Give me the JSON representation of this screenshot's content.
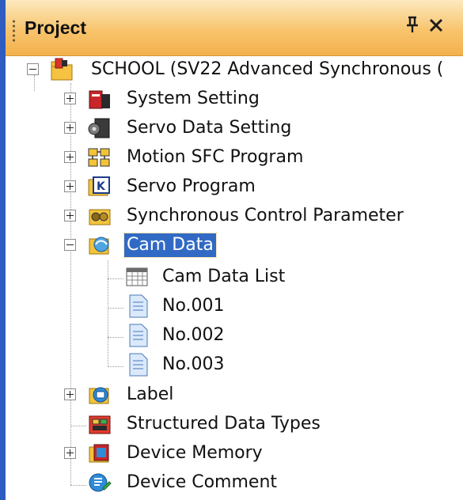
{
  "panel": {
    "title": "Project",
    "pin_icon": "pin-icon",
    "close_icon": "close-icon",
    "pin_glyph": "ᵖ",
    "close_glyph": "✕"
  },
  "tree": {
    "root": {
      "label": "SCHOOL (SV22 Advanced Synchronous (",
      "icon": "project-folder-icon",
      "expanded": true
    },
    "items": [
      {
        "label": "System Setting",
        "icon": "system-setting-icon",
        "expander": "plus"
      },
      {
        "label": "Servo Data Setting",
        "icon": "servo-data-icon",
        "expander": "plus"
      },
      {
        "label": "Motion SFC Program",
        "icon": "sfc-program-icon",
        "expander": "plus"
      },
      {
        "label": "Servo Program",
        "icon": "servo-program-icon",
        "expander": "plus"
      },
      {
        "label": "Synchronous Control Parameter",
        "icon": "sync-parameter-icon",
        "expander": "plus"
      },
      {
        "label": "Cam Data",
        "icon": "cam-data-icon",
        "expander": "minus",
        "selected": true
      },
      {
        "label": "Cam Data List",
        "icon": "list-icon",
        "child": true
      },
      {
        "label": "No.001",
        "icon": "document-icon",
        "child": true
      },
      {
        "label": "No.002",
        "icon": "document-icon",
        "child": true
      },
      {
        "label": "No.003",
        "icon": "document-icon",
        "child": true
      },
      {
        "label": "Label",
        "icon": "label-icon",
        "expander": "plus"
      },
      {
        "label": "Structured Data Types",
        "icon": "structured-data-icon"
      },
      {
        "label": "Device Memory",
        "icon": "device-memory-icon",
        "expander": "plus"
      },
      {
        "label": "Device Comment",
        "icon": "device-comment-icon"
      }
    ]
  }
}
